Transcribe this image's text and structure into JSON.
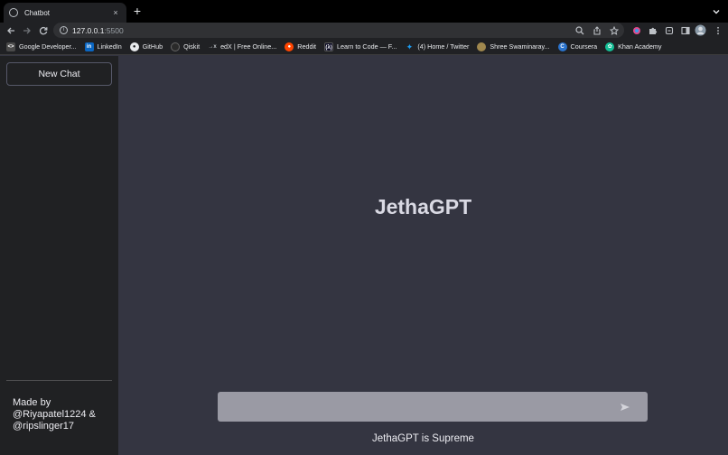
{
  "browser": {
    "tab": {
      "title": "Chatbot",
      "close": "×"
    },
    "new_tab": "+",
    "url_host": "127.0.0.1",
    "url_port": ":5500",
    "bookmarks": [
      {
        "label": "Google Developer...",
        "icon": "google-developers-icon",
        "color": "#4a4a4a"
      },
      {
        "label": "LinkedIn",
        "icon": "linkedin-icon",
        "color": "#0a66c2"
      },
      {
        "label": "GitHub",
        "icon": "github-icon",
        "color": "#e8eaed"
      },
      {
        "label": "Qiskit",
        "icon": "qiskit-icon",
        "color": "#2a2a2a"
      },
      {
        "label": "edX | Free Online...",
        "icon": "edx-icon",
        "color": "#202124"
      },
      {
        "label": "Reddit",
        "icon": "reddit-icon",
        "color": "#ff4500"
      },
      {
        "label": "Learn to Code — F...",
        "icon": "freecodecamp-icon",
        "color": "#0a0a23"
      },
      {
        "label": "(4) Home / Twitter",
        "icon": "twitter-icon",
        "color": "#1d9bf0"
      },
      {
        "label": "Shree Swaminaray...",
        "icon": "swaminarayan-icon",
        "color": "#a0884e"
      },
      {
        "label": "Coursera",
        "icon": "coursera-icon",
        "color": "#2a73cc"
      },
      {
        "label": "Khan Academy",
        "icon": "khan-academy-icon",
        "color": "#14bf96"
      }
    ]
  },
  "sidebar": {
    "new_chat_label": "New Chat",
    "credits_line1": "Made by",
    "credits_line2": "@Riyapatel1224 &",
    "credits_line3": "@ripslinger17"
  },
  "main": {
    "title": "JethaGPT",
    "input_value": "",
    "input_placeholder": "",
    "footer_note": "JethaGPT is Supreme"
  },
  "colors": {
    "sidebar_bg": "#202123",
    "main_bg": "#343541",
    "input_bg": "#9a9aa4"
  }
}
